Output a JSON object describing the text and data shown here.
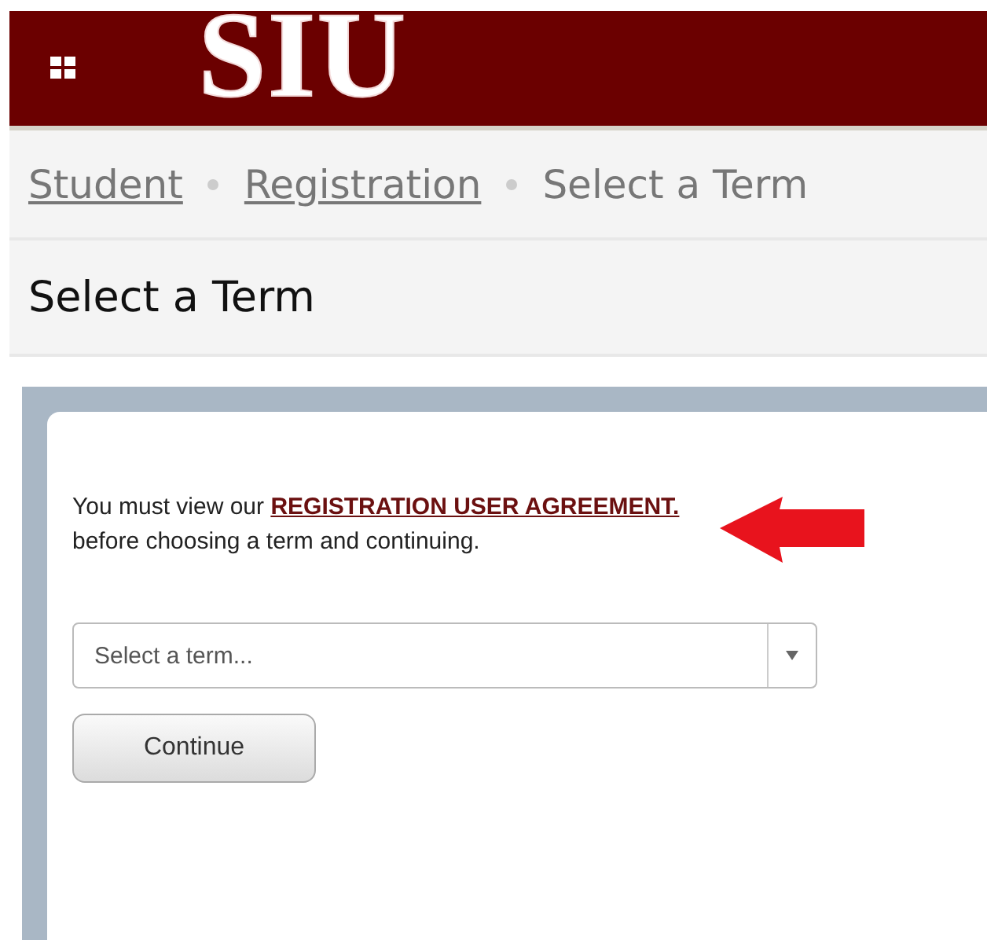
{
  "header": {
    "logo": "SIU"
  },
  "breadcrumb": [
    {
      "label": "Student",
      "kind": "link"
    },
    {
      "label": "Registration",
      "kind": "link"
    },
    {
      "label": "Select a Term",
      "kind": "current"
    }
  ],
  "page_title": "Select a Term",
  "message": {
    "before": "You must view our ",
    "link": "REGISTRATION USER AGREEMENT.",
    "after": " before choosing a term and continuing."
  },
  "term_select": {
    "placeholder": "Select a term..."
  },
  "buttons": [
    "Continue"
  ]
}
